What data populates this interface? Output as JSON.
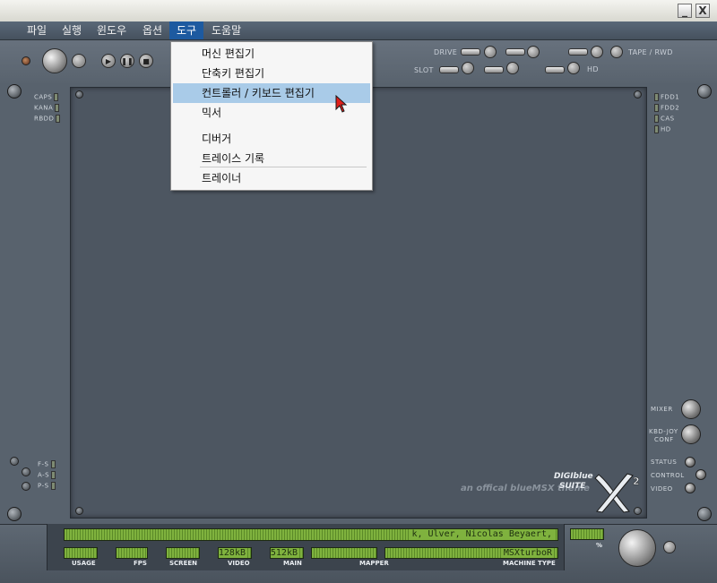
{
  "titlebar": {
    "minimize_label": "_",
    "close_label": "X"
  },
  "menu": {
    "items": [
      {
        "label": "파일"
      },
      {
        "label": "실행"
      },
      {
        "label": "윈도우"
      },
      {
        "label": "옵션"
      },
      {
        "label": "도구"
      },
      {
        "label": "도움말"
      }
    ],
    "active_index": 4
  },
  "dropdown": {
    "items": [
      {
        "label": "머신 편집기"
      },
      {
        "label": "단축키 편집기"
      },
      {
        "label": "컨트롤러 / 키보드 편집기"
      },
      {
        "label": "믹서"
      },
      {
        "label": "디버거"
      },
      {
        "label": "트레이스 기록"
      },
      {
        "label": "트레이너"
      }
    ],
    "highlighted_index": 2
  },
  "toolbar": {
    "drive_label": "DRIVE",
    "slot_label": "SLOT",
    "tape_label": "TAPE / RWD",
    "hd_label": "HD"
  },
  "left_indicators": {
    "top": [
      "CAPS",
      "KANA",
      "RBDD"
    ],
    "bottom": [
      "F-S",
      "A-S",
      "P-S"
    ]
  },
  "right_indicators": {
    "top": [
      "FDD1",
      "FDD2",
      "CAS",
      "HD"
    ],
    "bottom": {
      "mixer": "MIXER",
      "kbd_joy_line1": "KBD-JOY",
      "kbd_joy_line2": "CONF",
      "status": "STATUS",
      "control": "CONTROL",
      "video": "VIDEO"
    }
  },
  "branding": {
    "digiblue": "DIGIblue",
    "suite": "SUITE",
    "tagline": "an offical blueMSX theme"
  },
  "status": {
    "scroll_text": "k,  Ulver,  Nicolas Beyaert,",
    "usage_label": "USAGE",
    "fps_label": "FPS",
    "screen_label": "SCREEN",
    "video_label": "VIDEO",
    "video_value": "128kB",
    "main_label": "MAIN",
    "main_value": "512kB",
    "mapper_label": "MAPPER",
    "machine_label": "MACHINE TYPE",
    "machine_value": "MSXturboR",
    "percent_label": "%"
  },
  "colors": {
    "menu_active": "#1d5aa0",
    "dropdown_highlight": "#a9cbe8",
    "lcd_green": "#7fb23e"
  }
}
